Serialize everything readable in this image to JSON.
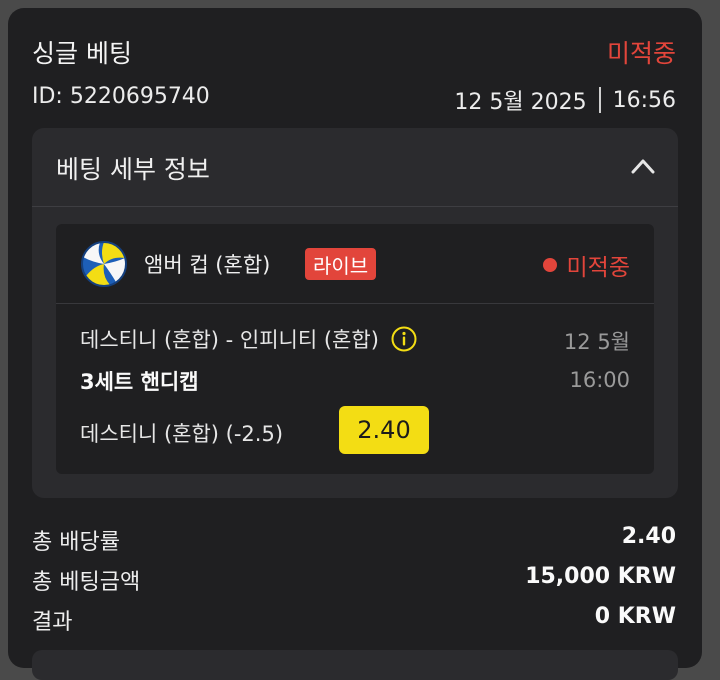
{
  "header": {
    "title": "싱글 베팅",
    "status": "미적중",
    "bet_id": "ID: 5220695740",
    "date": "12 5월 2025",
    "time": "16:56"
  },
  "details": {
    "section_title": "베팅 세부 정보",
    "event": {
      "league": "앰버 컵 (혼합)",
      "live_badge": "라이브",
      "status": "미적중",
      "match": "데스티니 (혼합) - 인피니티 (혼합)",
      "date": "12 5월",
      "market": "3세트 핸디캡",
      "time": "16:00",
      "selection": "데스티니 (혼합) (-2.5)",
      "odds": "2.40"
    }
  },
  "summary": [
    {
      "label": "총 배당률",
      "value": "2.40"
    },
    {
      "label": "총 베팅금액",
      "value": "15,000 KRW"
    },
    {
      "label": "결과",
      "value": "0 KRW"
    }
  ],
  "colors": {
    "accent_red": "#e2453b",
    "odds_yellow": "#f3dd14",
    "card_bg": "#1f1f21",
    "panel_bg": "#2b2b2e"
  },
  "icons": {
    "sport": "volleyball-icon",
    "collapse": "chevron-up-icon",
    "info": "info-icon",
    "status_dot": "status-dot-icon"
  }
}
